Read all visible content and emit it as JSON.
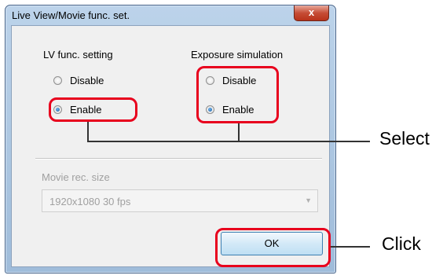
{
  "window": {
    "title": "Live View/Movie func. set.",
    "close_glyph": "x"
  },
  "lv_func": {
    "label": "LV func. setting",
    "options": [
      {
        "label": "Disable",
        "selected": false
      },
      {
        "label": "Enable",
        "selected": true
      }
    ]
  },
  "exposure_sim": {
    "label": "Exposure simulation",
    "options": [
      {
        "label": "Disable",
        "selected": false
      },
      {
        "label": "Enable",
        "selected": true
      }
    ]
  },
  "movie_rec": {
    "label": "Movie rec. size",
    "value": "1920x1080  30 fps",
    "enabled": false
  },
  "ok_button": {
    "label": "OK"
  },
  "callouts": {
    "select": "Select",
    "click": "Click"
  },
  "colors": {
    "highlight": "#e8001d",
    "ok_border": "#3c7fb1",
    "close_button": "#c64d36"
  }
}
